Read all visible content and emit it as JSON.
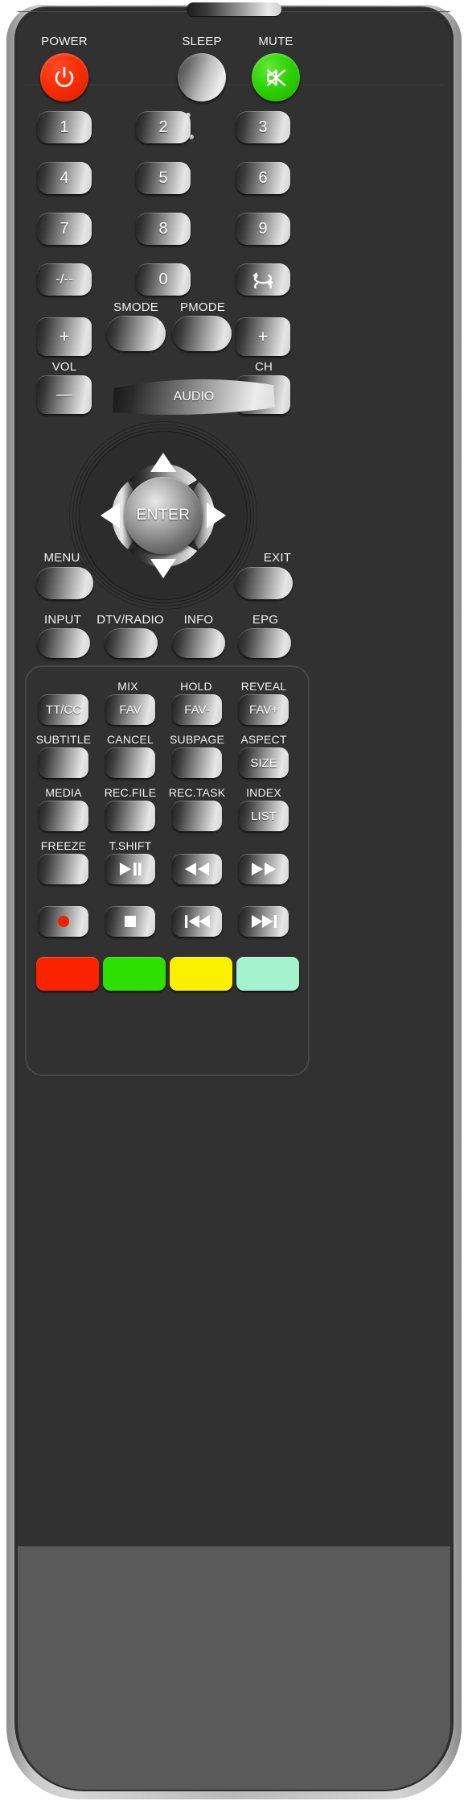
{
  "device": {
    "kind": "tv-remote-control",
    "body_color": "#313131",
    "battery_door_color": "#5a5a5a",
    "bezel_color": "#c9c9c9"
  },
  "top_row": {
    "power_label": "POWER",
    "power_icon": "power-icon",
    "sleep_label": "SLEEP",
    "mute_label": "MUTE",
    "mute_icon": "mute-speaker-icon",
    "power_color": "#fa2d05",
    "mute_color": "#2fd305"
  },
  "keypad": {
    "rows": [
      [
        {
          "label": "1"
        },
        {
          "label": "2"
        },
        {
          "label": "3"
        }
      ],
      [
        {
          "label": "4"
        },
        {
          "label": "5"
        },
        {
          "label": "6"
        }
      ],
      [
        {
          "label": "7"
        },
        {
          "label": "8"
        },
        {
          "label": "9"
        }
      ],
      [
        {
          "label": "-/--"
        },
        {
          "label": "0"
        },
        {
          "label": "",
          "icon": "swap-return-icon"
        }
      ]
    ]
  },
  "mode_row": {
    "vol_plus": "+",
    "smode_label": "SMODE",
    "pmode_label": "PMODE",
    "ch_plus": "+"
  },
  "volume_row": {
    "vol_label": "VOL",
    "vol_minus": "—",
    "audio_label": "AUDIO",
    "ch_label": "CH",
    "ch_minus": "—"
  },
  "navigation": {
    "up_icon": "arrow-up-icon",
    "down_icon": "arrow-down-icon",
    "left_icon": "arrow-left-icon",
    "right_icon": "arrow-right-icon",
    "enter_label": "ENTER"
  },
  "menu_row": {
    "menu_label": "MENU",
    "exit_label": "EXIT"
  },
  "function_row": [
    {
      "label": "INPUT"
    },
    {
      "label": "DTV/RADIO"
    },
    {
      "label": "INFO"
    },
    {
      "label": "EPG"
    }
  ],
  "teletext_panel": {
    "row1": [
      {
        "top": "",
        "face": "TT/CC"
      },
      {
        "top": "MIX",
        "face": "FAV"
      },
      {
        "top": "HOLD",
        "face": "FAV-"
      },
      {
        "top": "REVEAL",
        "face": "FAV+"
      }
    ],
    "row2": [
      {
        "top": "SUBTITLE",
        "face": ""
      },
      {
        "top": "CANCEL",
        "face": ""
      },
      {
        "top": "SUBPAGE",
        "face": ""
      },
      {
        "top": "ASPECT",
        "face": "SIZE"
      }
    ],
    "row3": [
      {
        "top": "MEDIA",
        "face": ""
      },
      {
        "top": "REC.FILE",
        "face": ""
      },
      {
        "top": "REC.TASK",
        "face": ""
      },
      {
        "top": "INDEX",
        "face": "LIST"
      }
    ],
    "row4": [
      {
        "top": "FREEZE",
        "face": "",
        "icon": ""
      },
      {
        "top": "T.SHIFT",
        "face": "",
        "icon": "play-pause-icon"
      },
      {
        "top": "",
        "face": "",
        "icon": "rewind-icon"
      },
      {
        "top": "",
        "face": "",
        "icon": "fast-forward-icon"
      }
    ],
    "row5": [
      {
        "icon": "record-icon"
      },
      {
        "icon": "stop-icon"
      },
      {
        "icon": "previous-track-icon"
      },
      {
        "icon": "next-track-icon"
      }
    ],
    "color_keys": [
      {
        "name": "red-key",
        "color": "#fa2200"
      },
      {
        "name": "green-key",
        "color": "#2ee000"
      },
      {
        "name": "yellow-key",
        "color": "#fbf000"
      },
      {
        "name": "cyan-key",
        "color": "#a4f2ce"
      }
    ]
  }
}
